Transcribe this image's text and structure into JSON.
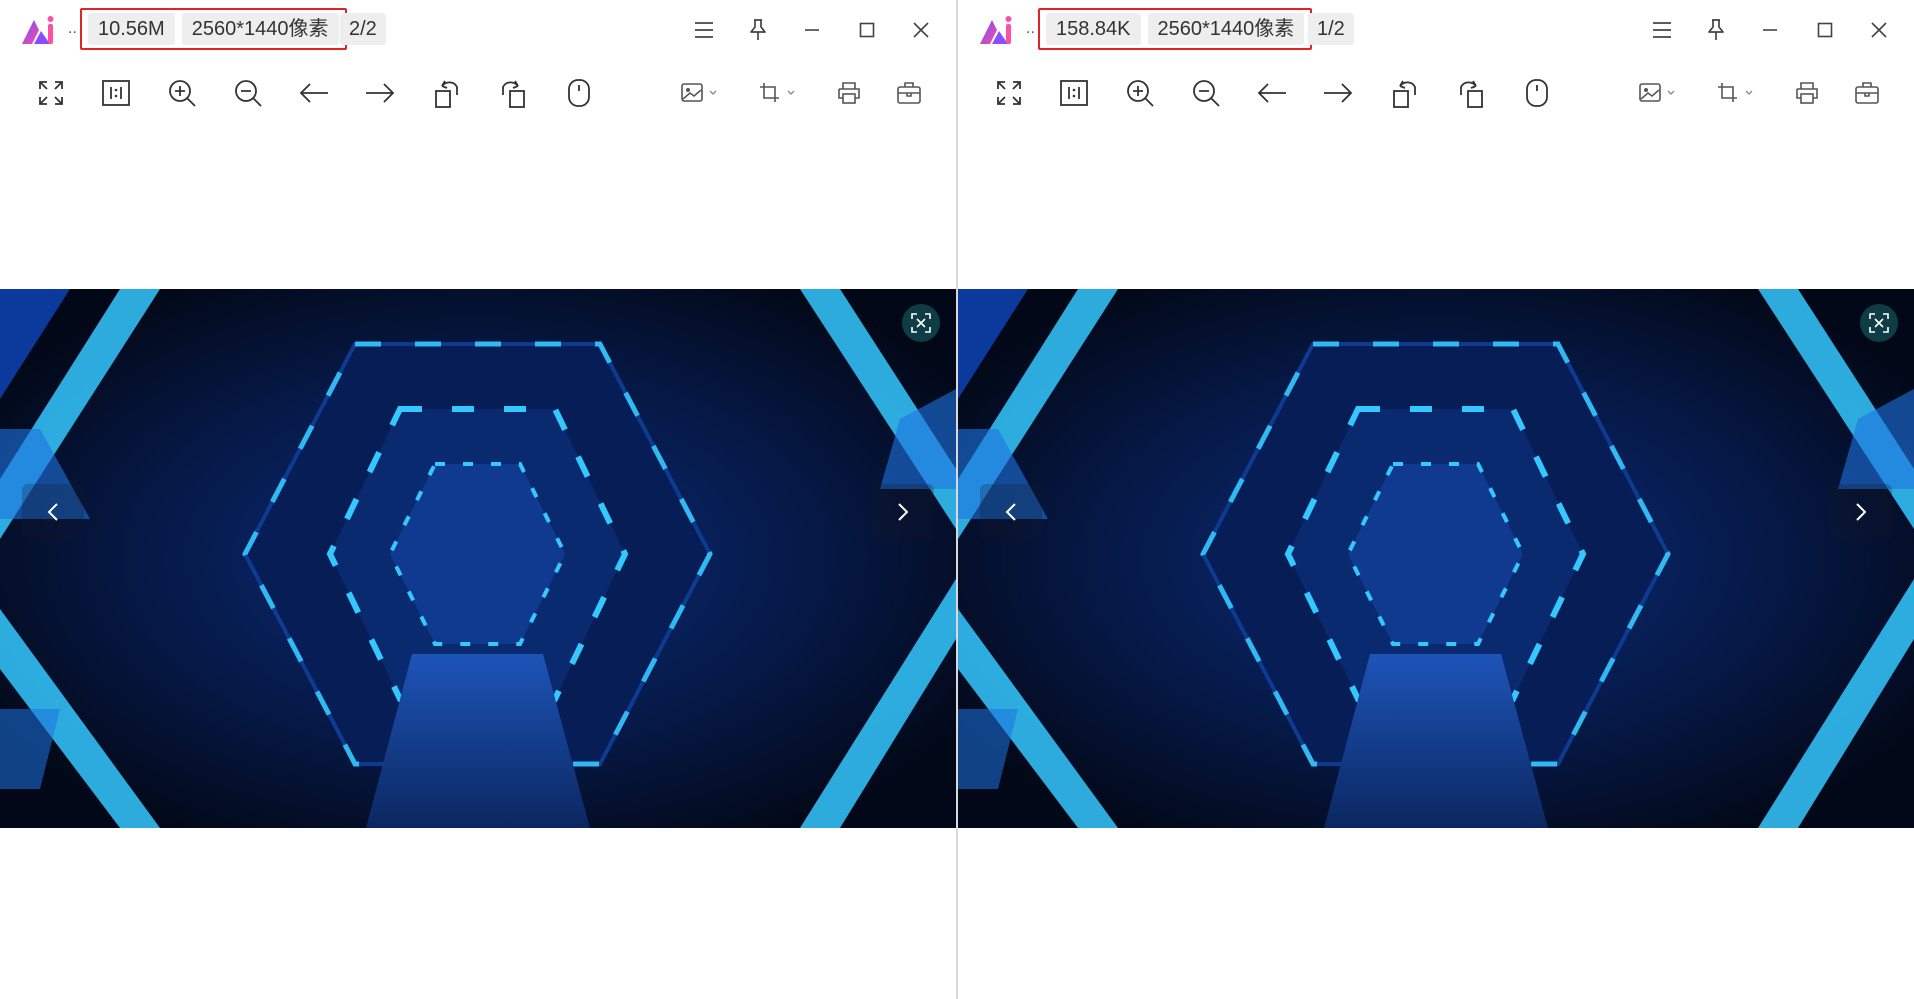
{
  "panes": [
    {
      "file_size": "10.56M",
      "dimensions": "2560*1440像素",
      "page_indicator": "2/2",
      "title_ellipsis": ".."
    },
    {
      "file_size": "158.84K",
      "dimensions": "2560*1440像素",
      "page_indicator": "1/2",
      "title_ellipsis": ".."
    }
  ],
  "toolbar_icons": [
    "fullscreen-icon",
    "actual-size-icon",
    "zoom-in-icon",
    "zoom-out-icon",
    "arrow-left-icon",
    "arrow-right-icon",
    "rotate-left-icon",
    "rotate-right-icon",
    "mouse-icon",
    "image-edit-icon",
    "crop-icon",
    "print-icon",
    "toolbox-icon"
  ],
  "window_icons": [
    "menu-icon",
    "pin-icon",
    "minimize-icon",
    "maximize-icon",
    "close-icon"
  ],
  "colors": {
    "highlight_border": "#e02424",
    "chip_bg": "#eeeeee",
    "neon": "#35c8ff",
    "image_bg": "#030b22"
  }
}
